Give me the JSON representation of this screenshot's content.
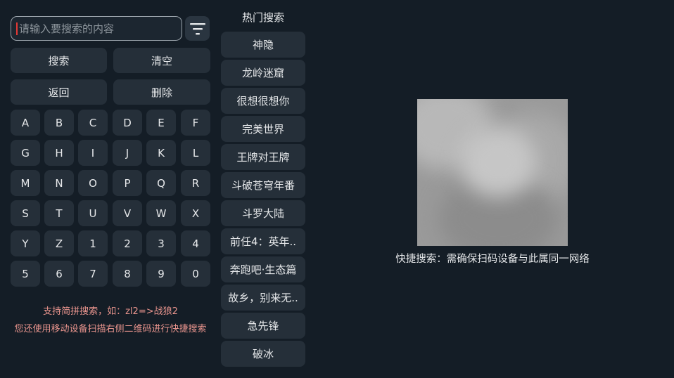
{
  "search": {
    "placeholder": "请输入要搜索的内容"
  },
  "actions": {
    "search": "搜索",
    "clear": "清空",
    "back": "返回",
    "delete": "删除"
  },
  "keys": [
    "A",
    "B",
    "C",
    "D",
    "E",
    "F",
    "G",
    "H",
    "I",
    "J",
    "K",
    "L",
    "M",
    "N",
    "O",
    "P",
    "Q",
    "R",
    "S",
    "T",
    "U",
    "V",
    "W",
    "X",
    "Y",
    "Z",
    "1",
    "2",
    "3",
    "4",
    "5",
    "6",
    "7",
    "8",
    "9",
    "0"
  ],
  "hints": {
    "line1": "支持简拼搜索，如：zl2=>战狼2",
    "line2": "您还使用移动设备扫描右侧二维码进行快捷搜索"
  },
  "hot": {
    "title": "热门搜索",
    "items": [
      "神隐",
      "龙岭迷窟",
      "很想很想你",
      "完美世界",
      "王牌对王牌",
      "斗破苍穹年番",
      "斗罗大陆",
      "前任4：英年..",
      "奔跑吧·生态篇",
      "故乡，别来无..",
      "急先锋",
      "破冰"
    ]
  },
  "qr": {
    "caption": "快捷搜索：需确保扫码设备与此属同一网络"
  }
}
